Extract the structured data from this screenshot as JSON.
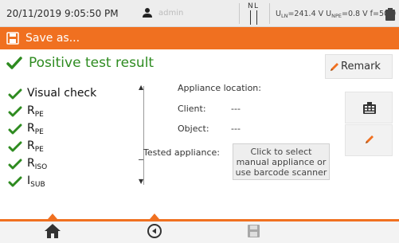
{
  "status_bar": {
    "datetime": "20/11/2019 9:05:50 PM",
    "user": "admin",
    "phase_n": "N",
    "phase_l": "L",
    "uln_label": "U",
    "uln_sub": "LN",
    "uln_value": "=241.4 V",
    "upe_label": "U",
    "upe_sub": "NPE",
    "upe_value": "=0.8 V",
    "freq": "f=50.0 Hz",
    "icons": [
      "user-icon",
      "battery-icon"
    ]
  },
  "title_bar": {
    "title": "Save as...",
    "icon": "save-icon"
  },
  "result": {
    "title": "Positive test result",
    "icon": "check-icon"
  },
  "remark_button": {
    "label": "Remark",
    "icon": "pencil-icon"
  },
  "checks": [
    {
      "label": "Visual check",
      "sub": ""
    },
    {
      "label": "R",
      "sub": "PE"
    },
    {
      "label": "R",
      "sub": "PE"
    },
    {
      "label": "R",
      "sub": "PE"
    },
    {
      "label": "R",
      "sub": "ISO"
    },
    {
      "label": "I",
      "sub": "SUB"
    }
  ],
  "info": {
    "appliance_location_label": "Appliance location:",
    "client_label": "Client:",
    "client_value": "---",
    "object_label": "Object:",
    "object_value": "---",
    "tested_appliance_label": "Tested appliance:",
    "select_button": "Click to select manual appliance or use barcode scanner"
  },
  "side_buttons": [
    "keypad-icon",
    "pencil-icon"
  ],
  "bottom_nav": [
    "home-icon",
    "back-circle-icon",
    "save-icon"
  ],
  "colors": {
    "accent": "#f07020",
    "ok_green": "#2e8b20",
    "status_bar_bg": "#ededed"
  }
}
